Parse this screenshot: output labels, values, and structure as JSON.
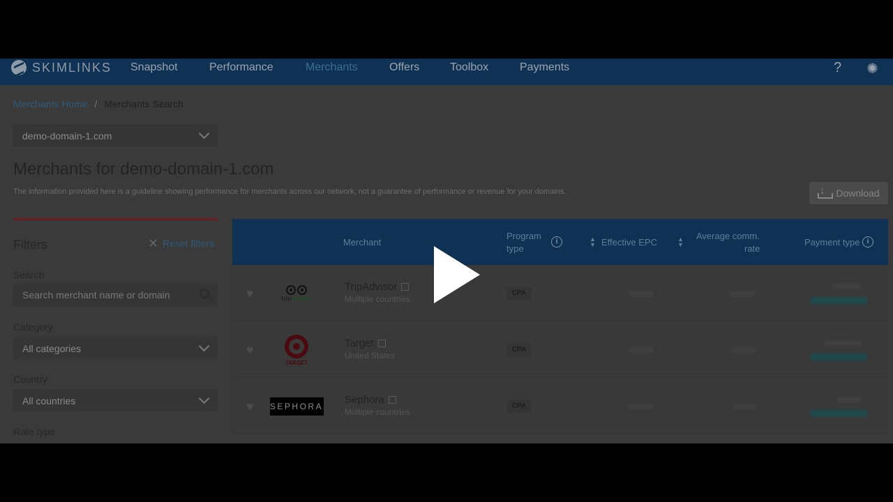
{
  "nav": {
    "brand": "SKIMLINKS",
    "items": [
      {
        "label": "Snapshot",
        "active": false
      },
      {
        "label": "Performance",
        "active": false
      },
      {
        "label": "Merchants",
        "active": true
      },
      {
        "label": "Offers",
        "active": false
      },
      {
        "label": "Toolbox",
        "active": false
      },
      {
        "label": "Payments",
        "active": false
      }
    ],
    "help_icon": "help-icon",
    "settings_icon": "gear-icon"
  },
  "breadcrumb": {
    "home": "Merchants Home",
    "separator": "/",
    "current": "Merchants Search"
  },
  "domain_select": {
    "value": "demo-domain-1.com"
  },
  "page": {
    "title": "Merchants for demo-domain-1.com",
    "description": "The information provided here is a guideline showing performance for merchants across our network, not a guarantee of performance or revenue for your domains.",
    "download_label": "Download"
  },
  "filters": {
    "title": "Filters",
    "reset_label": "Reset filters",
    "search_label": "Search",
    "search_placeholder": "Search merchant name or domain",
    "category_label": "Category",
    "category_value": "All categories",
    "country_label": "Country",
    "country_value": "All countries",
    "rate_type_label": "Rate type"
  },
  "table": {
    "headers": {
      "merchant": "Merchant",
      "program_type_1": "Program",
      "program_type_2": "type",
      "effective_epc": "Effective EPC",
      "avg_comm_1": "Average comm.",
      "avg_comm_2": "rate",
      "payment_type": "Payment type"
    },
    "rows": [
      {
        "name": "TripAdvisor",
        "country": "Multiple countries",
        "program_type": "CPA",
        "logo": "tripadvisor-logo"
      },
      {
        "name": "Target",
        "country": "United States",
        "program_type": "CPA",
        "logo": "target-logo"
      },
      {
        "name": "Sephora",
        "country": "Multiple countries",
        "program_type": "CPA",
        "logo": "sephora-logo"
      }
    ]
  },
  "logos": {
    "tripadvisor_text_a": "trip",
    "tripadvisor_text_b": "advisor",
    "target_text": "TARGET",
    "sephora_text": "SEPHORA"
  },
  "colors": {
    "nav_bg": "#0f3154",
    "link": "#2f5a78",
    "accent_bar": "#6a1c1f",
    "overlay_play": "#ffffff"
  }
}
